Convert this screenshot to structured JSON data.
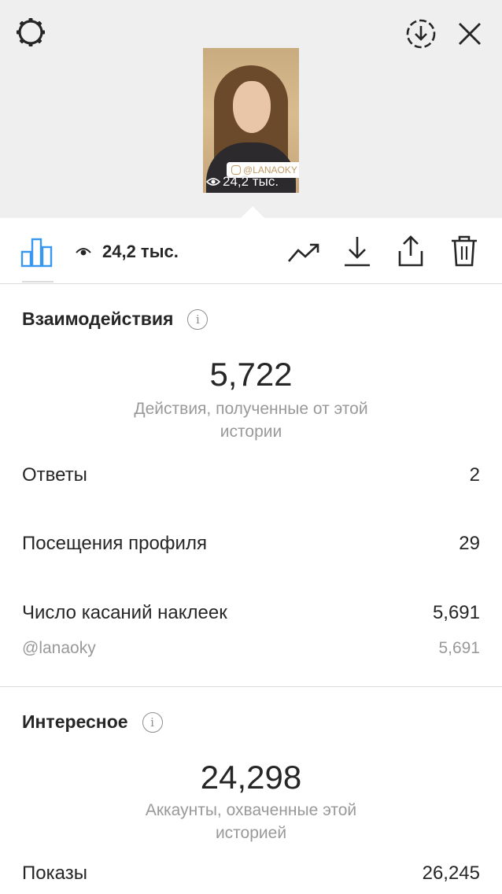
{
  "header": {
    "settings_icon": "gear-icon",
    "save_icon": "download-circle-icon",
    "close_icon": "close-icon",
    "story_thumbnail": {
      "mention_label": "@LANAOKY",
      "views_label": "24,2 тыс."
    }
  },
  "toolbar": {
    "insights_icon": "bar-chart-icon",
    "views_icon": "eye-icon",
    "views_count": "24,2 тыс.",
    "promote_icon": "trending-up-icon",
    "download_icon": "download-icon",
    "share_icon": "share-icon",
    "delete_icon": "trash-icon"
  },
  "interactions": {
    "title": "Взаимодействия",
    "total": "5,722",
    "caption": "Действия, полученные от этой истории",
    "rows": [
      {
        "label": "Ответы",
        "value": "2"
      },
      {
        "label": "Посещения профиля",
        "value": "29"
      },
      {
        "label": "Число касаний наклеек",
        "value": "5,691"
      }
    ],
    "sticker_detail": {
      "label": "@lanaoky",
      "value": "5,691"
    }
  },
  "discovery": {
    "title": "Интересное",
    "total": "24,298",
    "caption": "Аккаунты, охваченные этой историей",
    "rows": [
      {
        "label": "Показы",
        "value": "26,245"
      }
    ]
  },
  "colors": {
    "header_bg": "#efefef",
    "text_primary": "#262626",
    "text_secondary": "#999999",
    "accent_blue": "#3897f0",
    "divider": "#dbdbdb"
  }
}
